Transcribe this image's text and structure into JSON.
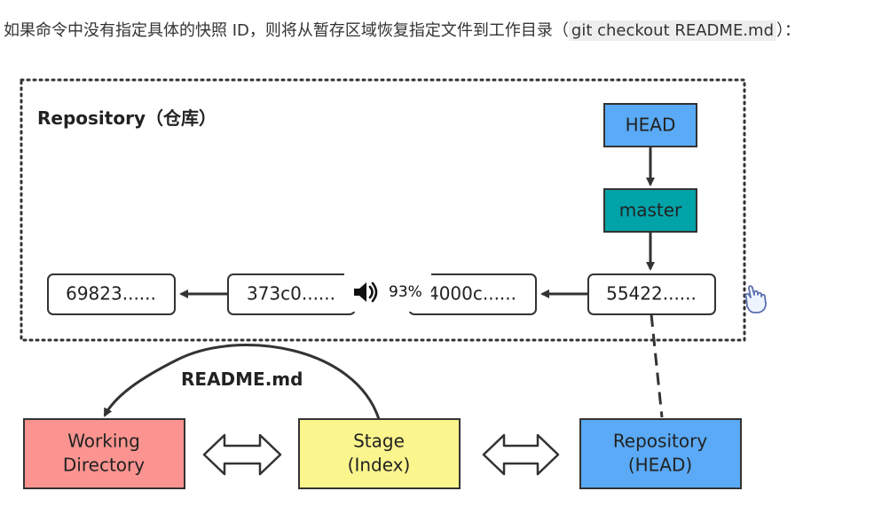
{
  "intro": {
    "text": "如果命令中没有指定具体的快照 ID，则将从暂存区域恢复指定文件到工作目录（",
    "code": "git checkout README.md",
    "suffix": "）："
  },
  "repository": {
    "label": "Repository（仓库）"
  },
  "refs": {
    "head": "HEAD",
    "master": "master"
  },
  "commits": [
    {
      "id": "69823......"
    },
    {
      "id": "373c0......"
    },
    {
      "id": "4000c......"
    },
    {
      "id": "55422......"
    }
  ],
  "areas": {
    "working": {
      "line1": "Working",
      "line2": "Directory"
    },
    "stage": {
      "line1": "Stage",
      "line2": "(Index)"
    },
    "repo": {
      "line1": "Repository",
      "line2": "(HEAD)"
    }
  },
  "flow_label": "README.md",
  "volume": {
    "level_text": "93%"
  },
  "colors": {
    "head_fill": "#5aaaf7",
    "master_fill": "#00a3a8",
    "working_fill": "#fb9490",
    "stage_fill": "#fbf58d",
    "repo_fill": "#5aaaf7",
    "border": "#333333"
  },
  "icons": {
    "volume": "speaker-icon",
    "cursor": "hand-cursor-icon"
  }
}
